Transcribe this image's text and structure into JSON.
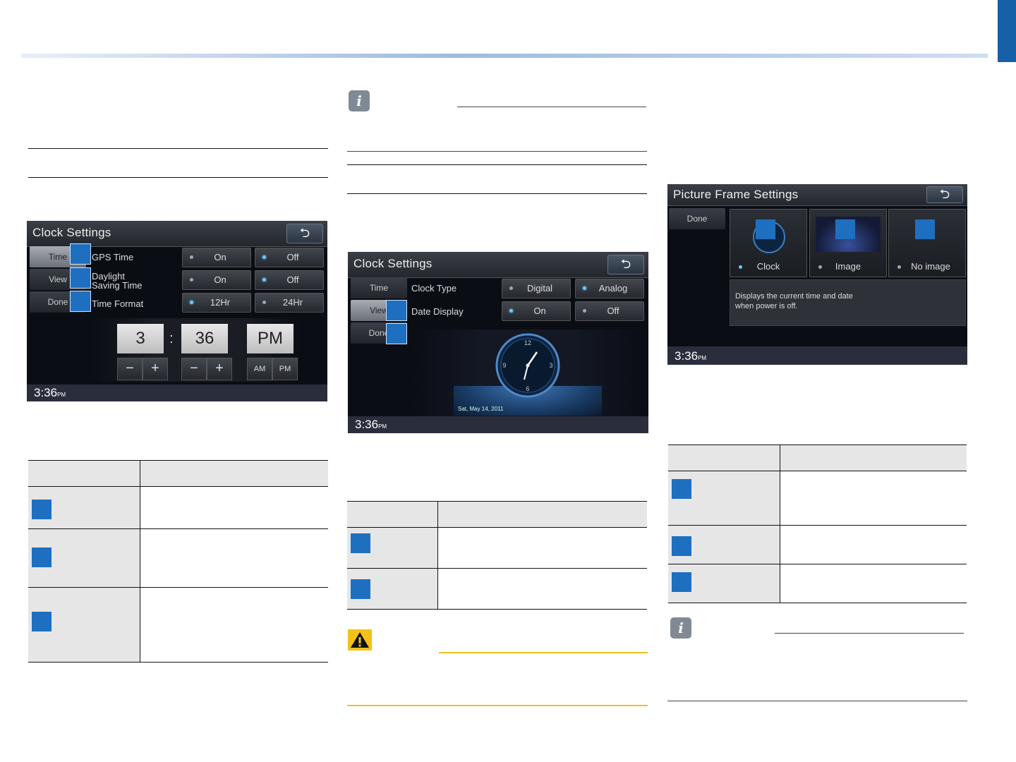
{
  "screens": {
    "clock_time": {
      "title": "Clock Settings",
      "back_glyph": "⮌",
      "tabs": [
        "Time",
        "View",
        "Done"
      ],
      "rows": [
        {
          "label": "GPS Time",
          "options": [
            "On",
            "Off"
          ],
          "selected": 1
        },
        {
          "label": "Daylight\nSaving Time",
          "options": [
            "On",
            "Off"
          ],
          "selected": 1
        },
        {
          "label": "Time Format",
          "options": [
            "12Hr",
            "24Hr"
          ],
          "selected": 0
        }
      ],
      "hour": "3",
      "separator": ":",
      "minute": "36",
      "meridiem": "PM",
      "minus": "−",
      "plus": "+",
      "am": "AM",
      "pm": "PM",
      "status_time": "3:36",
      "status_suffix": "PM"
    },
    "clock_view": {
      "title": "Clock Settings",
      "back_glyph": "⮌",
      "tabs": [
        "Time",
        "View",
        "Done"
      ],
      "rows": [
        {
          "label": "Clock Type",
          "options": [
            "Digital",
            "Analog"
          ],
          "selected": 1
        },
        {
          "label": "Date Display",
          "options": [
            "On",
            "Off"
          ],
          "selected": 0
        }
      ],
      "dial_numbers": [
        "12",
        "3",
        "6",
        "9"
      ],
      "date_text": "Sat, May 14, 2011",
      "status_time": "3:36",
      "status_suffix": "PM"
    },
    "picture_frame": {
      "title": "Picture Frame Settings",
      "back_glyph": "⮌",
      "done": "Done",
      "options": [
        "Clock",
        "Image",
        "No image"
      ],
      "selected": 0,
      "description": "Displays the current time and date\nwhen power is off.",
      "status_time": "3:36",
      "status_suffix": "PM"
    }
  },
  "tables": {
    "left": {
      "rows": 3
    },
    "middle": {
      "rows": 2
    },
    "right": {
      "rows": 3
    }
  },
  "colors": {
    "badge_blue": "#1f6fc0",
    "header_blue": "#1660a8",
    "caution_yellow": "#f2c21b",
    "table_header_gray": "#e6e6e6"
  },
  "icons": [
    "info-icon",
    "caution-icon",
    "back-arrow-icon"
  ]
}
